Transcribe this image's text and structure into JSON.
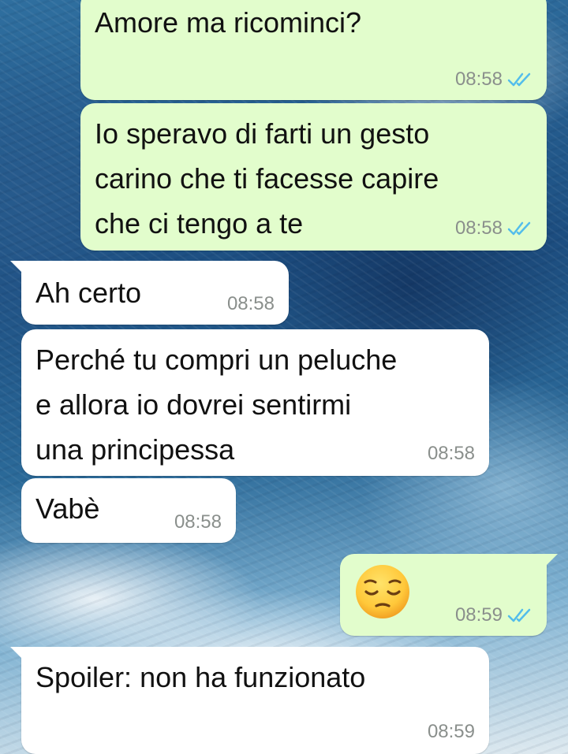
{
  "messages": [
    {
      "direction": "outgoing",
      "text": "Amore ma ricominci?",
      "time": "08:58",
      "status": "read"
    },
    {
      "direction": "outgoing",
      "text": "Io speravo di farti un gesto\ncarino che ti facesse capire\nche ci tengo a te",
      "time": "08:58",
      "status": "read"
    },
    {
      "direction": "incoming",
      "text": "Ah certo",
      "time": "08:58"
    },
    {
      "direction": "incoming",
      "text": "Perché tu compri un peluche\ne allora io dovrei sentirmi\nuna principessa",
      "time": "08:58"
    },
    {
      "direction": "incoming",
      "text": "Vabè",
      "time": "08:58"
    },
    {
      "direction": "outgoing",
      "emoji": "pensive-face",
      "time": "08:59",
      "status": "read"
    },
    {
      "direction": "incoming",
      "text": "Spoiler: non ha funzionato",
      "time": "08:59"
    }
  ],
  "colors": {
    "outgoing_bubble": "#e2fdcc",
    "incoming_bubble": "#ffffff",
    "read_ticks": "#53bdeb",
    "timestamp": "#8a8f8c"
  },
  "icons": {
    "read_receipt": "double-check-icon"
  }
}
